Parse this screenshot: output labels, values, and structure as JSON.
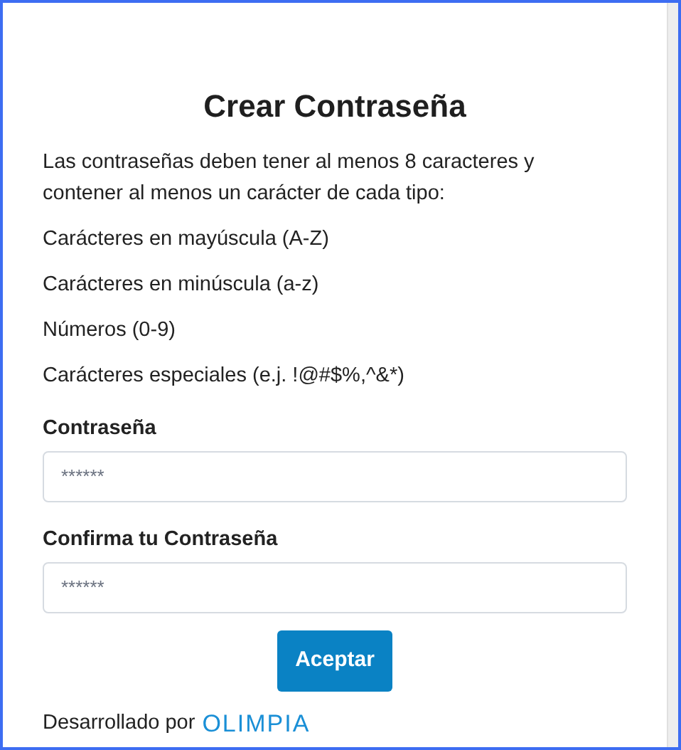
{
  "title": "Crear Contraseña",
  "intro": "Las contraseñas deben tener al menos 8 caracteres y contener al menos un carácter de cada tipo:",
  "requirements": [
    "Carácteres en mayúscula (A-Z)",
    "Carácteres en minúscula (a-z)",
    "Números (0-9)",
    "Carácteres especiales (e.j. !@#$%,^&*)"
  ],
  "fields": [
    {
      "label": "Contraseña",
      "placeholder": "******"
    },
    {
      "label": "Confirma tu Contraseña",
      "placeholder": "******"
    }
  ],
  "submit_button": "Aceptar",
  "footer": {
    "text": "Desarrollado por",
    "logo": "OLIMPIA"
  }
}
